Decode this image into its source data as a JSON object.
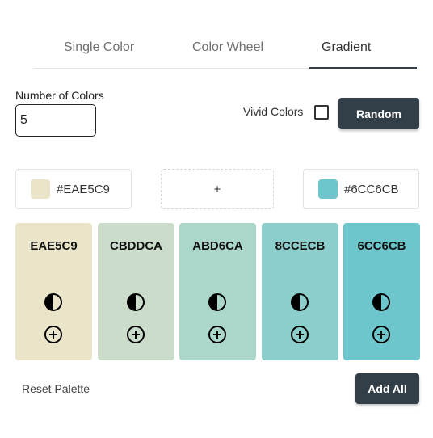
{
  "tabs": [
    {
      "label": "Single Color"
    },
    {
      "label": "Color Wheel"
    },
    {
      "label": "Gradient"
    }
  ],
  "active_tab": "Gradient",
  "form": {
    "number_label": "Number of Colors",
    "number_value": "5",
    "vivid_label": "Vivid Colors",
    "vivid_checked": false,
    "random_label": "Random"
  },
  "gradient": {
    "start": {
      "hex": "#EAE5C9",
      "color": "#EAE5C9"
    },
    "add_label": "+",
    "end": {
      "hex": "#6CC6CB",
      "color": "#6CC6CB"
    }
  },
  "palette": [
    {
      "code": "EAE5C9",
      "color": "#EAE5C9"
    },
    {
      "code": "CBDDCA",
      "color": "#CBDDCA"
    },
    {
      "code": "ABD6CA",
      "color": "#ABD6CA"
    },
    {
      "code": "8CCECB",
      "color": "#8CCECB"
    },
    {
      "code": "6CC6CB",
      "color": "#6CC6CB"
    }
  ],
  "footer": {
    "reset_label": "Reset Palette",
    "add_all_label": "Add All"
  },
  "colors": {
    "button_dark": "#323E48"
  }
}
